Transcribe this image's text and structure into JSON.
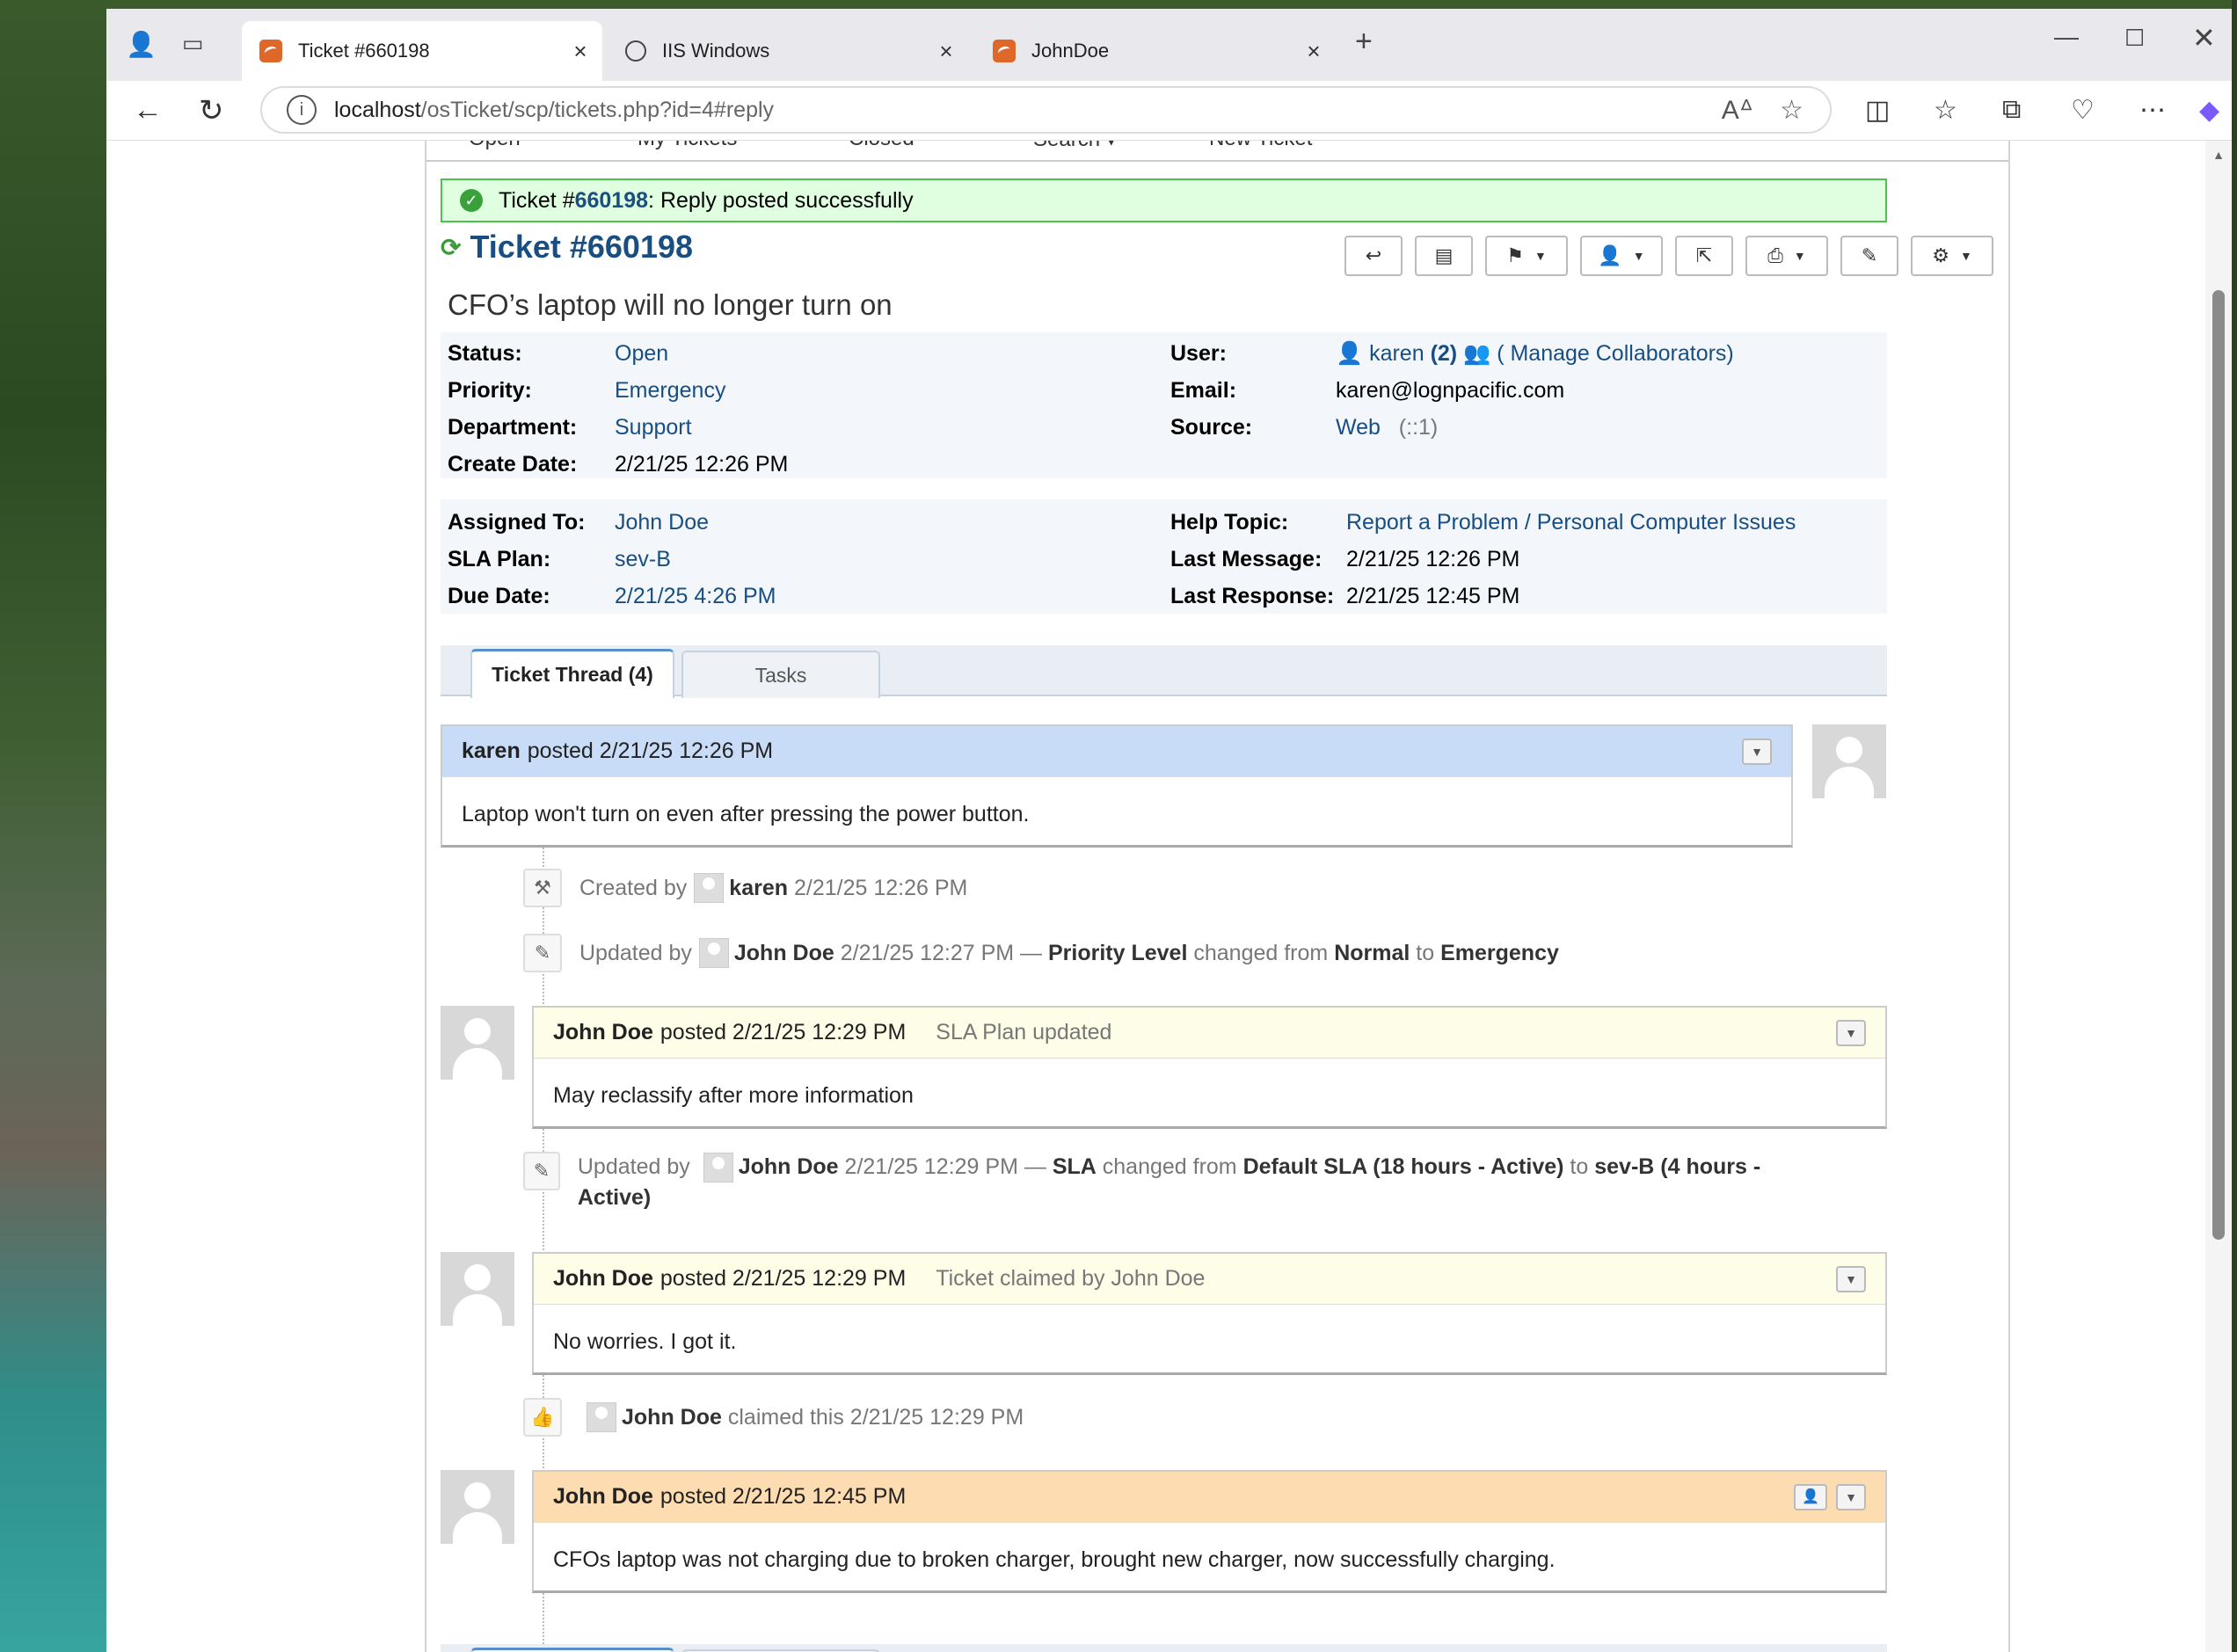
{
  "browser": {
    "tabs": [
      {
        "label": "Ticket #660198",
        "active": true
      },
      {
        "label": "IIS Windows",
        "active": false
      },
      {
        "label": "JohnDoe",
        "active": false
      }
    ],
    "url_host": "localhost",
    "url_path": "/osTicket/scp/tickets.php?id=4#reply"
  },
  "subnav": {
    "items": [
      "Open",
      "My Tickets",
      "Closed",
      "Search ▾",
      "New Ticket"
    ]
  },
  "alert": {
    "prefix": "Ticket #",
    "ticket_number": "660198",
    "suffix": ": Reply posted successfully"
  },
  "ticket": {
    "title": "Ticket #660198",
    "subject": "CFO’s laptop will no longer turn on"
  },
  "info": {
    "status_label": "Status:",
    "status": "Open",
    "priority_label": "Priority:",
    "priority": "Emergency",
    "department_label": "Department:",
    "department": "Support",
    "create_date_label": "Create Date:",
    "create_date": "2/21/25 12:26 PM",
    "user_label": "User:",
    "user": "karen",
    "user_count": "(2)",
    "collaborators": "( Manage Collaborators)",
    "email_label": "Email:",
    "email": "karen@lognpacific.com",
    "source_label": "Source:",
    "source": "Web",
    "source_ip": "(::1)",
    "assigned_label": "Assigned To:",
    "assigned": "John Doe",
    "sla_label": "SLA Plan:",
    "sla": "sev-B",
    "due_label": "Due Date:",
    "due": "2/21/25 4:26 PM",
    "help_topic_label": "Help Topic:",
    "help_topic": "Report a Problem / Personal Computer Issues",
    "last_message_label": "Last Message:",
    "last_message": "2/21/25 12:26 PM",
    "last_response_label": "Last Response:",
    "last_response": "2/21/25 12:45 PM"
  },
  "thread_tabs": {
    "thread": "Ticket Thread (4)",
    "tasks": "Tasks"
  },
  "thread": {
    "entry1": {
      "author": "karen",
      "posted": "posted 2/21/25 12:26 PM",
      "body": "Laptop won't turn on even after pressing the power button."
    },
    "event1": {
      "prefix": "Created by",
      "user": "karen",
      "time": "2/21/25 12:26 PM"
    },
    "event2": {
      "prefix": "Updated by",
      "user": "John Doe",
      "time": "2/21/25 12:27 PM —",
      "field": "Priority Level",
      "changed": "changed from",
      "from": "Normal",
      "to_word": "to",
      "to": "Emergency"
    },
    "entry2": {
      "author": "John Doe",
      "posted": "posted 2/21/25 12:29 PM",
      "note": "SLA Plan updated",
      "body": "May reclassify after more information"
    },
    "event3": {
      "prefix": "Updated by",
      "user": "John Doe",
      "time": "2/21/25 12:29 PM —",
      "field": "SLA",
      "changed": "changed from",
      "from": "Default SLA (18 hours - Active)",
      "to_word": "to",
      "to": "sev-B (4 hours - Active)"
    },
    "entry3": {
      "author": "John Doe",
      "posted": "posted 2/21/25 12:29 PM",
      "note": "Ticket claimed by John Doe",
      "body": "No worries. I got it."
    },
    "event4": {
      "user": "John Doe",
      "text": "claimed this 2/21/25 12:29 PM"
    },
    "entry4": {
      "author": "John Doe",
      "posted": "posted 2/21/25 12:45 PM",
      "body": "CFOs laptop was not charging due to broken charger, brought new charger, now successfully charging."
    }
  }
}
